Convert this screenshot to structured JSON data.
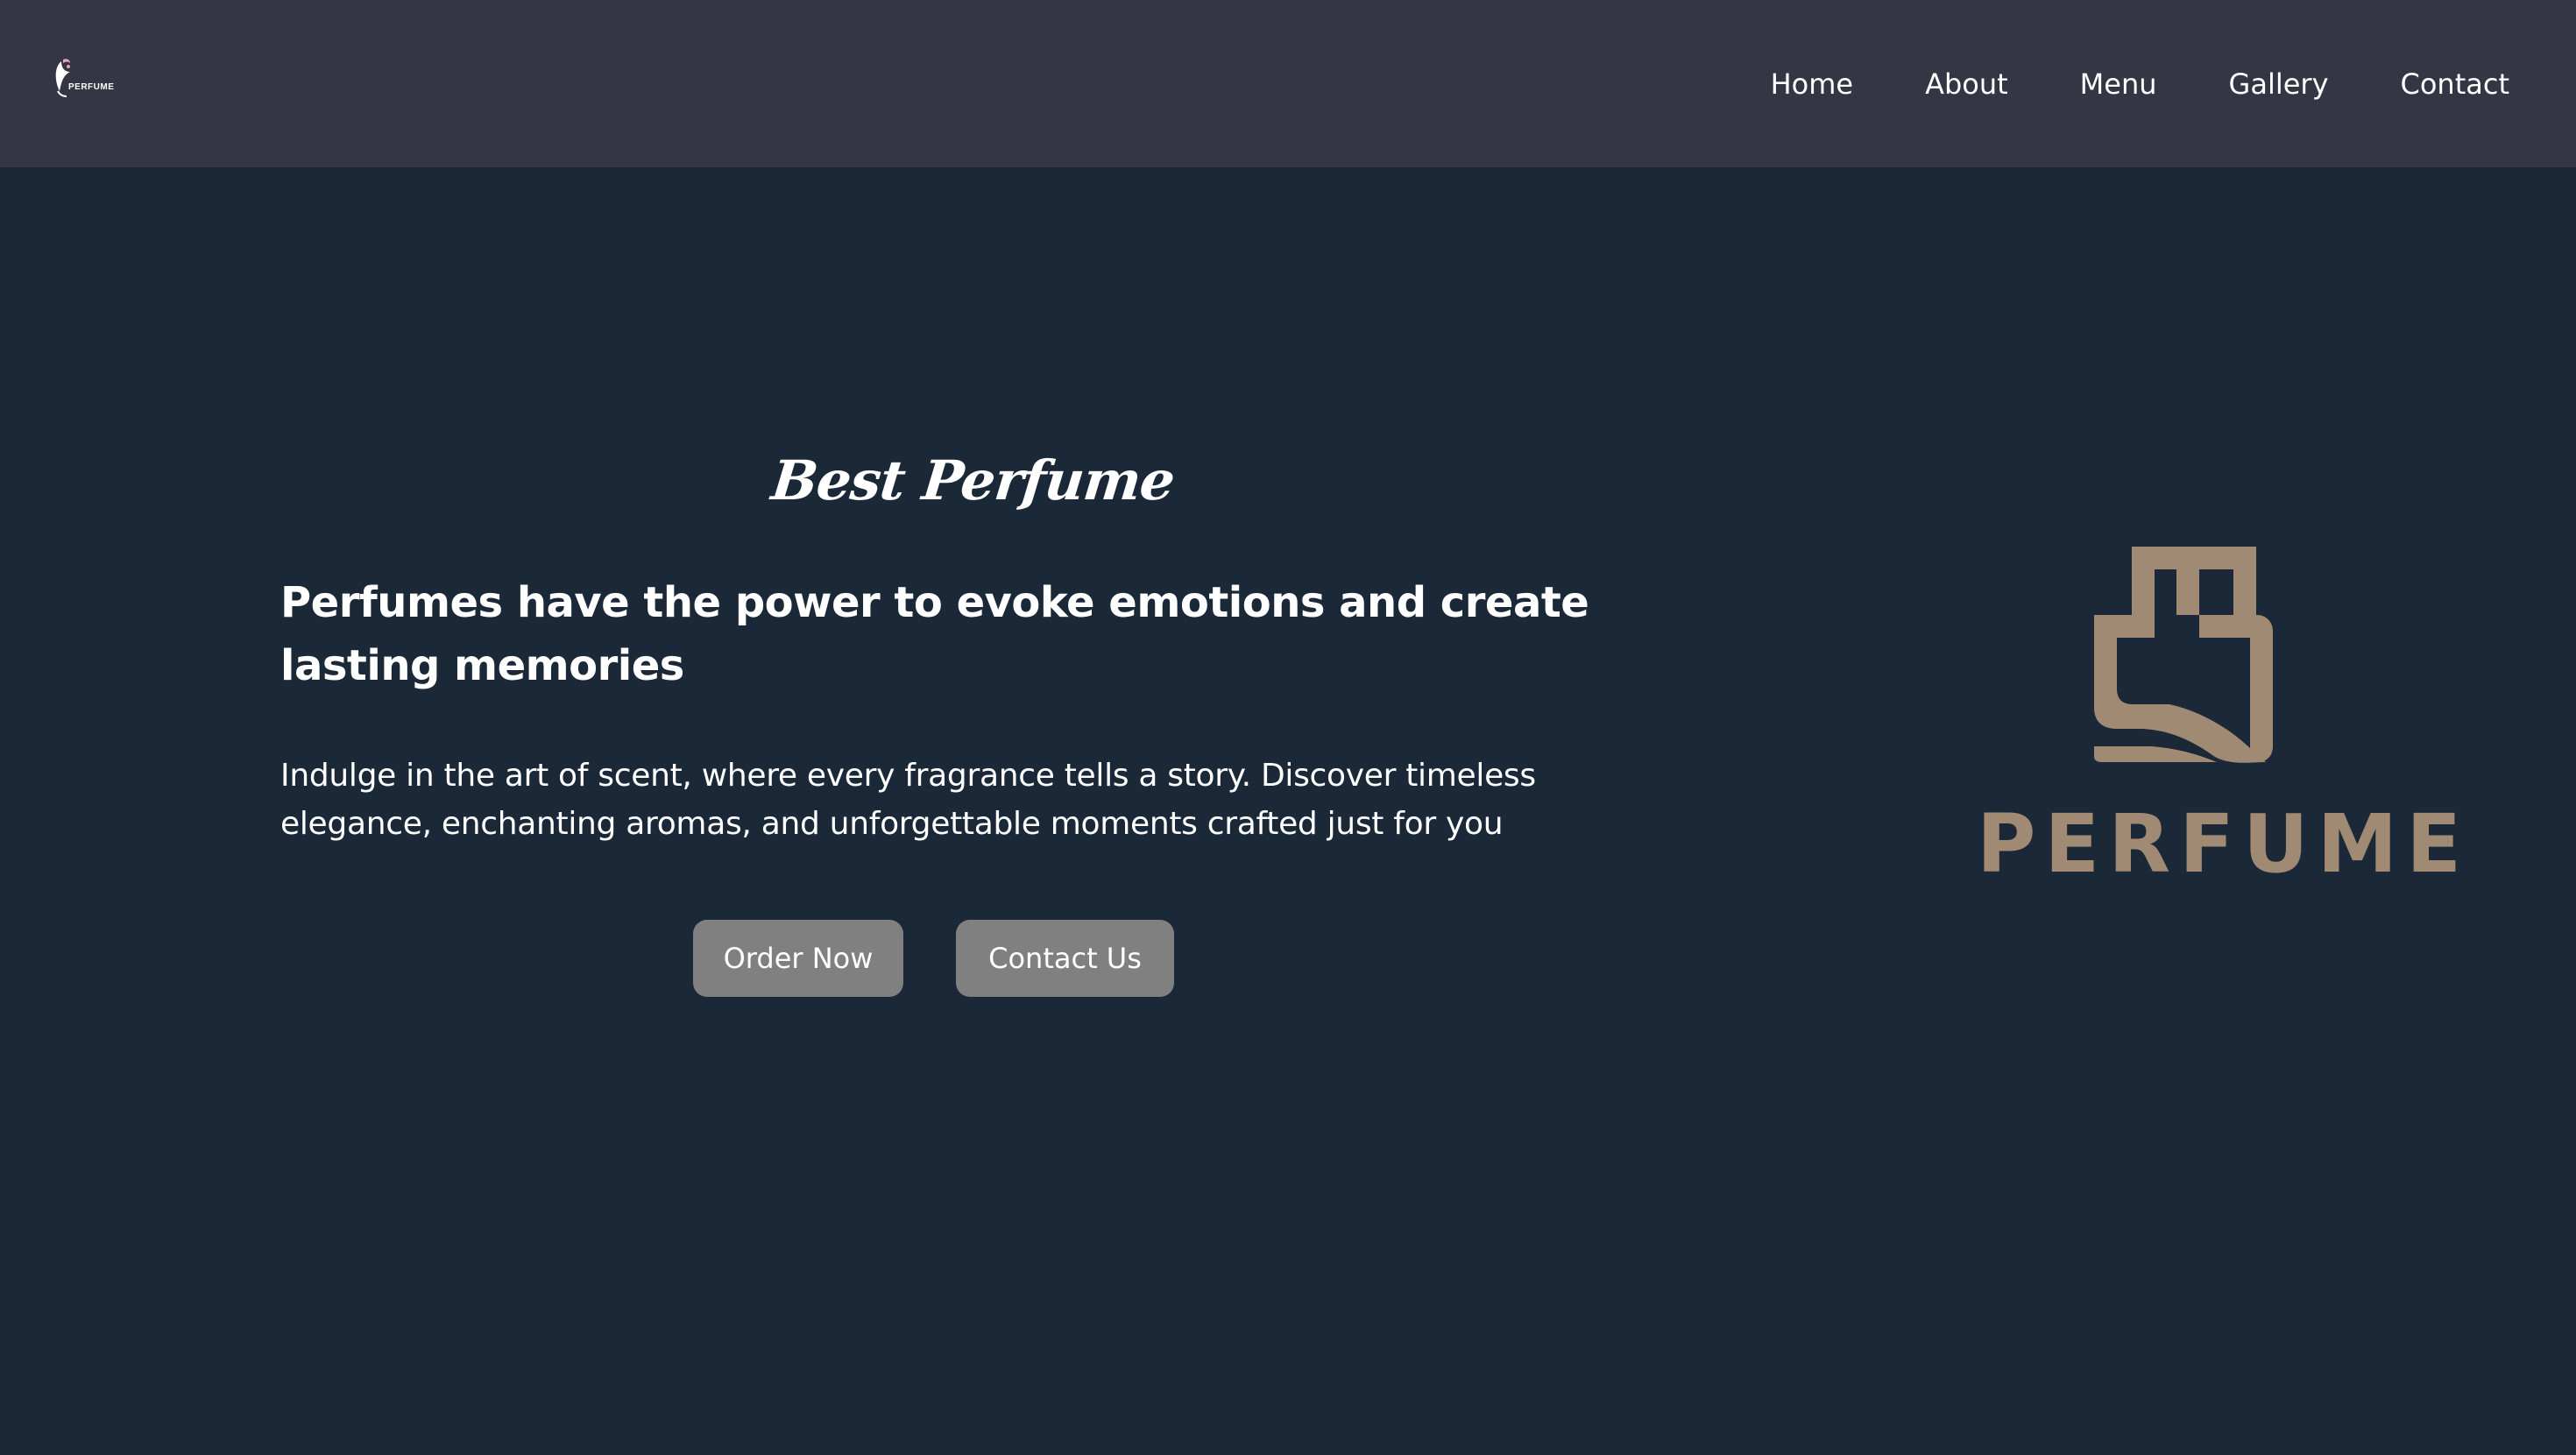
{
  "navbar": {
    "logo_text": "PERFUME",
    "links": [
      "Home",
      "About",
      "Menu",
      "Gallery",
      "Contact"
    ]
  },
  "hero": {
    "script_title": "Best Perfume",
    "heading": "Perfumes have the power to evoke emotions and create lasting memories",
    "description": "Indulge in the art of scent, where every fragrance tells a story. Discover timeless elegance, enchanting aromas, and unforgettable moments crafted just for you",
    "order_button": "Order Now",
    "contact_button": "Contact Us"
  },
  "brand": {
    "logo_text": "PERFUME",
    "icon": "perfume-bottle-icon"
  },
  "colors": {
    "navbar_bg": "#343644",
    "page_bg": "#1b2838",
    "button_bg": "#808080",
    "brand_accent": "#a18a73"
  }
}
